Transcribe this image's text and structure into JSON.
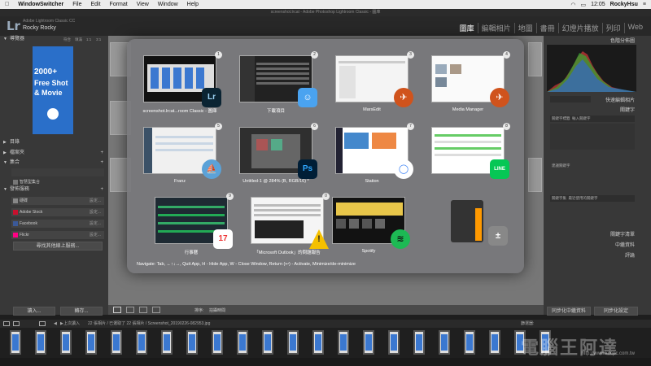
{
  "menubar": {
    "app": "WindowSwitcher",
    "items": [
      "File",
      "Edit",
      "Format",
      "View",
      "Window",
      "Help"
    ],
    "time": "12:05",
    "user": "RockyHsu"
  },
  "window": {
    "title": "screenshot.lrcat - Adobe Photoshop Lightroom Classic - 圖庫"
  },
  "lightroom": {
    "logo": "Lr",
    "product": "Adobe Lightroom Classic CC",
    "catalog_name": "Rocky Rocky",
    "modules": [
      "圖庫",
      "編輯相片",
      "地圖",
      "書冊",
      "幻燈片播放",
      "列印",
      "Web"
    ],
    "active_module": "圖庫"
  },
  "left_panel": {
    "navigator": "導覽器",
    "nav_zoom": [
      "符合",
      "填滿",
      "1:1",
      "3:1"
    ],
    "preview_text": [
      "2000+",
      "Free Shot",
      "& Movie"
    ],
    "sections": [
      "目錄",
      "檔案夾",
      "集合",
      "發佈服務"
    ],
    "collection_item": "智慧型集合",
    "publish_services": [
      {
        "name": "硬碟",
        "action": "設定...",
        "color": "#888888"
      },
      {
        "name": "Adobe Stock",
        "action": "設定...",
        "color": "#c8102e"
      },
      {
        "name": "Facebook",
        "action": "設定...",
        "color": "#3b5998"
      },
      {
        "name": "Flickr",
        "action": "設定...",
        "color": "#ff0084"
      }
    ],
    "find_more": "尋找其他線上服務...",
    "import_button": "讀入...",
    "export_button": "轉存..."
  },
  "right_panel": {
    "histogram": "色階分佈圖",
    "quick_develop": "快速編輯相片",
    "keywording": "關鍵字",
    "keyword_tags_label": "關鍵字標籤",
    "keyword_tags_value": "輸入關鍵字",
    "keyword_suggestions": "建議關鍵字",
    "keyword_set_label": "關鍵字集",
    "keyword_set_value": "最近使用的關鍵字",
    "keyword_list": "關鍵字清單",
    "metadata": "中繼資料",
    "comments": "評論",
    "sync_metadata": "同步化中繼資料",
    "sync_settings": "同步化設定"
  },
  "toolbar": {
    "sort_label": "排序:",
    "sort_value": "拍攝時間"
  },
  "filmstrip": {
    "source_previous": "上次讀入",
    "info": "22 張相片 / 已選取了 22 張相片 / Screenshot_20190226-082953.jpg",
    "filter": "篩選器:"
  },
  "switcher": {
    "windows": [
      {
        "num": "1",
        "title": "screenshot.lrcat...room Classic - 圖庫",
        "icon": "Lr",
        "icon_name": "lightroom-icon"
      },
      {
        "num": "2",
        "title": "下載項目",
        "icon": "☺",
        "icon_name": "finder-icon"
      },
      {
        "num": "3",
        "title": "MarsEdit",
        "icon": "✈",
        "icon_name": "marsedit-icon"
      },
      {
        "num": "4",
        "title": "Media Manager",
        "icon": "✈",
        "icon_name": "marsedit-icon"
      },
      {
        "num": "5",
        "title": "Franz",
        "icon": "⛵",
        "icon_name": "franz-icon"
      },
      {
        "num": "6",
        "title": "Untitled-1 @ 284% (B, RGB/16) *",
        "icon": "Ps",
        "icon_name": "photoshop-icon"
      },
      {
        "num": "7",
        "title": "Station",
        "icon": "◯",
        "icon_name": "station-icon"
      },
      {
        "num": "8",
        "title": "",
        "icon": "LINE",
        "icon_name": "line-icon"
      },
      {
        "num": "9",
        "title": "行事曆",
        "icon": "17",
        "icon_name": "calendar-icon"
      },
      {
        "num": "0",
        "title": "「Microsoft Outlook」的問題報告",
        "icon": "!",
        "icon_name": "warning-icon"
      },
      {
        "num": "",
        "title": "Spotify",
        "icon": "≋",
        "icon_name": "spotify-icon"
      },
      {
        "num": "",
        "title": "",
        "icon": "±",
        "icon_name": "calculator-icon"
      }
    ],
    "help": "Navigate: Tab, ←↑↓→, Quit App, H - Hide App, W - Close Window, Return (↩) - Activate, Minimize/de-minimize"
  },
  "watermark": {
    "text": "電腦王阿達",
    "url": "http://www.kocpc.com.tw"
  }
}
